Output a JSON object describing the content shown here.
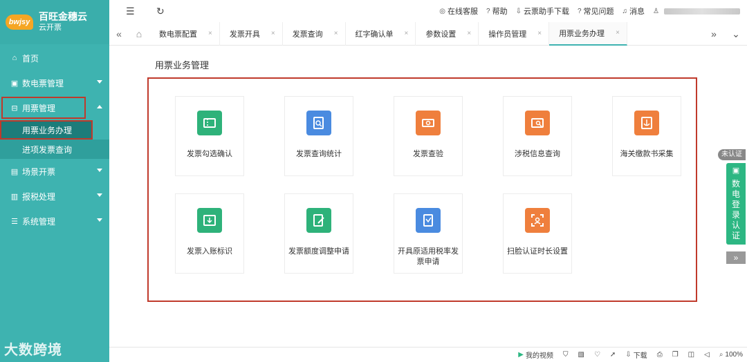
{
  "app": {
    "title": "百旺金穗云",
    "subtitle": "云开票",
    "logo_text": "bwjsy"
  },
  "sidebar": {
    "items": [
      {
        "label": "首页",
        "icon": "home-icon",
        "glyph": "⌂"
      },
      {
        "label": "数电票管理",
        "icon": "invoice-icon",
        "glyph": "▣"
      },
      {
        "label": "用票管理",
        "icon": "ticket-icon",
        "glyph": "⊟"
      },
      {
        "label": "场景开票",
        "icon": "scene-icon",
        "glyph": "▤"
      },
      {
        "label": "报税处理",
        "icon": "chart-icon",
        "glyph": "▥"
      },
      {
        "label": "系统管理",
        "icon": "settings-icon",
        "glyph": "☰"
      }
    ],
    "sub_items": [
      "用票业务办理",
      "进项发票查询"
    ]
  },
  "topbar": {
    "menu_glyph": "☰",
    "refresh_glyph": "↻",
    "links": [
      {
        "label": "在线客服",
        "icon": "headset-icon",
        "glyph": "◎"
      },
      {
        "label": "帮助",
        "icon": "help-icon",
        "glyph": "?"
      },
      {
        "label": "云票助手下载",
        "icon": "download-icon",
        "glyph": "⇩"
      },
      {
        "label": "常见问题",
        "icon": "faq-icon",
        "glyph": "?"
      },
      {
        "label": "消息",
        "icon": "bell-icon",
        "glyph": "♫"
      }
    ],
    "user_glyph": "♙"
  },
  "tabs": {
    "prev_glyph": "«",
    "home_glyph": "⌂",
    "close_glyph": "×",
    "items": [
      "数电票配置",
      "发票开具",
      "发票查询",
      "红字确认单",
      "参数设置",
      "操作员管理",
      "用票业务办理"
    ],
    "next_glyph": "»",
    "more_glyph": "⌄"
  },
  "main": {
    "title": "用票业务管理",
    "cards": [
      {
        "label": "发票勾选确认",
        "color": "#2eb27a",
        "icon": "ticket-check-icon"
      },
      {
        "label": "发票查询统计",
        "color": "#4a8be0",
        "icon": "search-doc-icon"
      },
      {
        "label": "发票查验",
        "color": "#ef7f3d",
        "icon": "verify-ticket-icon"
      },
      {
        "label": "涉税信息查询",
        "color": "#ef7f3d",
        "icon": "tax-search-icon"
      },
      {
        "label": "海关缴款书采集",
        "color": "#ef7f3d",
        "icon": "customs-icon"
      },
      {
        "label": "发票入账标识",
        "color": "#2eb27a",
        "icon": "account-in-icon"
      },
      {
        "label": "发票额度调整申请",
        "color": "#2eb27a",
        "icon": "quota-edit-icon"
      },
      {
        "label": "开具原适用税率发票申请",
        "color": "#4a8be0",
        "icon": "rate-apply-icon"
      },
      {
        "label": "扫脸认证时长设置",
        "color": "#ef7f3d",
        "icon": "face-scan-icon"
      }
    ]
  },
  "auth_widget": {
    "badge": "未认证",
    "chars": [
      "数",
      "电",
      "登",
      "录",
      "认",
      "证"
    ],
    "expand_glyph": "»"
  },
  "statusbar": {
    "video_label": "我的视频",
    "download_label": "下载",
    "zoom": "100%"
  },
  "watermark": "大数跨境"
}
